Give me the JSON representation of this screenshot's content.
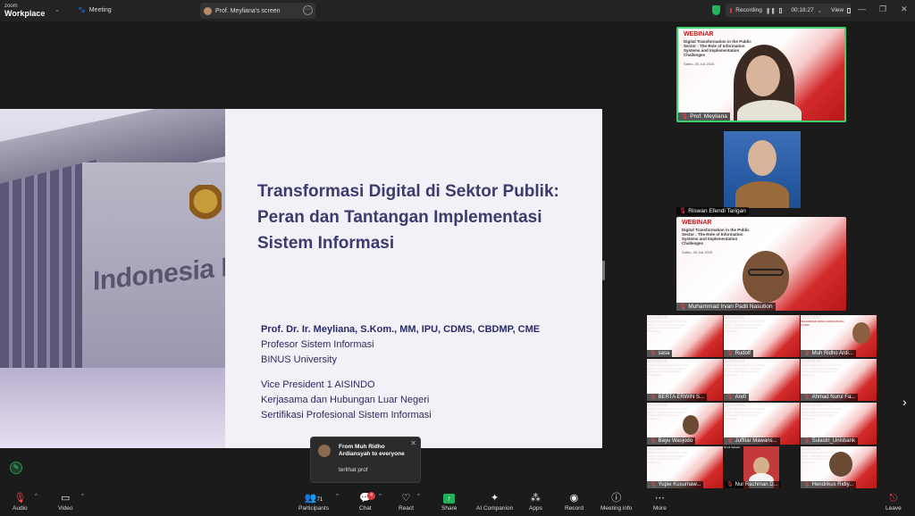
{
  "titlebar": {
    "brand_top": "zoom",
    "brand_bottom": "Workplace",
    "meeting_label": "Meeting",
    "screen_tab_label": "Prof. Meyliana's screen",
    "recording_label": "Recording",
    "timer": "00:18:27",
    "view_label": "View"
  },
  "slide": {
    "title": "Transformasi Digital di Sektor Publik: Peran dan Tantangan Implementasi Sistem Informasi",
    "photo_text": "Indonesia M",
    "name": "Prof. Dr. Ir. Meyliana, S.Kom., MM, IPU, CDMS, CBDMP, CME",
    "line1": "Profesor Sistem Informasi",
    "line2": "BINUS University",
    "line3": "Vice President 1 AISINDO",
    "line4": "Kerjasama dan Hubungan Luar Negeri",
    "line5": "Sertifikasi Profesional Sistem Informasi"
  },
  "webinar": {
    "title": "WEBINAR",
    "subtitle": "Digital Transformation in the Public Sector : The Role of Information Systems and Implementation Challenges",
    "date": "Sabtu, 26 Juli 2025"
  },
  "participants": {
    "main": [
      {
        "name": "Prof. Meyliana"
      },
      {
        "name": "Riswan Efendi Tarigan"
      },
      {
        "name": "Muhammad Irvan Padli Nasution"
      }
    ],
    "grid": [
      {
        "name": "sasa",
        "muted": true
      },
      {
        "name": "Rudolf",
        "muted": true
      },
      {
        "name": "Muh Ridho Ardi...",
        "muted": true,
        "caption": "MUHAMMAD RIDHO ARDIANSYAH, S.KOM"
      },
      {
        "name": "BERTA ERWIN S...",
        "muted": true
      },
      {
        "name": "Arefi",
        "muted": true
      },
      {
        "name": "Ahmad Nurul Fa...",
        "muted": true
      },
      {
        "name": "Bayu Wasjodo",
        "muted": true
      },
      {
        "name": "Juffitar Mawans...",
        "muted": true
      },
      {
        "name": "Sulastri_Unisbank",
        "muted": true
      },
      {
        "name": "Yupie Kusumaw...",
        "muted": true
      },
      {
        "name": "Nur Rachman D...",
        "muted": true,
        "caption": "Nurul Sahabu"
      },
      {
        "name": "Hendrikus Ridiy...",
        "muted": true
      }
    ]
  },
  "chat_popup": {
    "from": "From Muh Ridho Ardiansyah to everyone",
    "message": "terlihat prof"
  },
  "toolbar": {
    "audio": "Audio",
    "video": "Video",
    "participants": "Participants",
    "participants_count": "71",
    "chat": "Chat",
    "chat_badge": "4",
    "react": "React",
    "share": "Share",
    "ai_companion": "AI Companion",
    "apps": "Apps",
    "record": "Record",
    "meeting_info": "Meeting info",
    "more": "More",
    "leave": "Leave"
  },
  "colors": {
    "accent_green": "#22b35a",
    "record_red": "#e03a3a",
    "slide_title": "#3d3a6e"
  }
}
